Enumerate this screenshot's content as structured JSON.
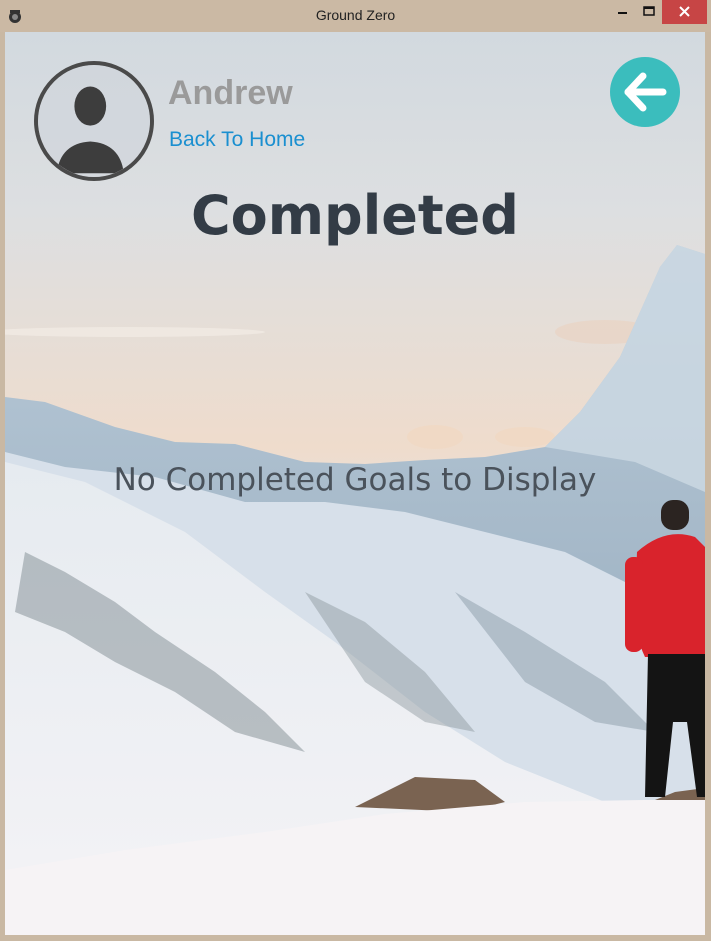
{
  "window": {
    "title": "Ground Zero",
    "app_icon": "camera-icon",
    "controls": [
      "minimize-icon",
      "maximize-icon",
      "close-icon"
    ]
  },
  "header": {
    "user_name": "Andrew",
    "back_home_label": "Back To Home",
    "avatar_icon": "user-avatar-icon",
    "back_icon": "arrow-left-icon"
  },
  "main": {
    "title": "Completed",
    "empty_message": "No Completed Goals to Display"
  },
  "colors": {
    "accent": "#3bbdbd",
    "link": "#1a8fd0",
    "title": "#333c46",
    "name": "#9a9a9a",
    "close": "#c74545"
  }
}
